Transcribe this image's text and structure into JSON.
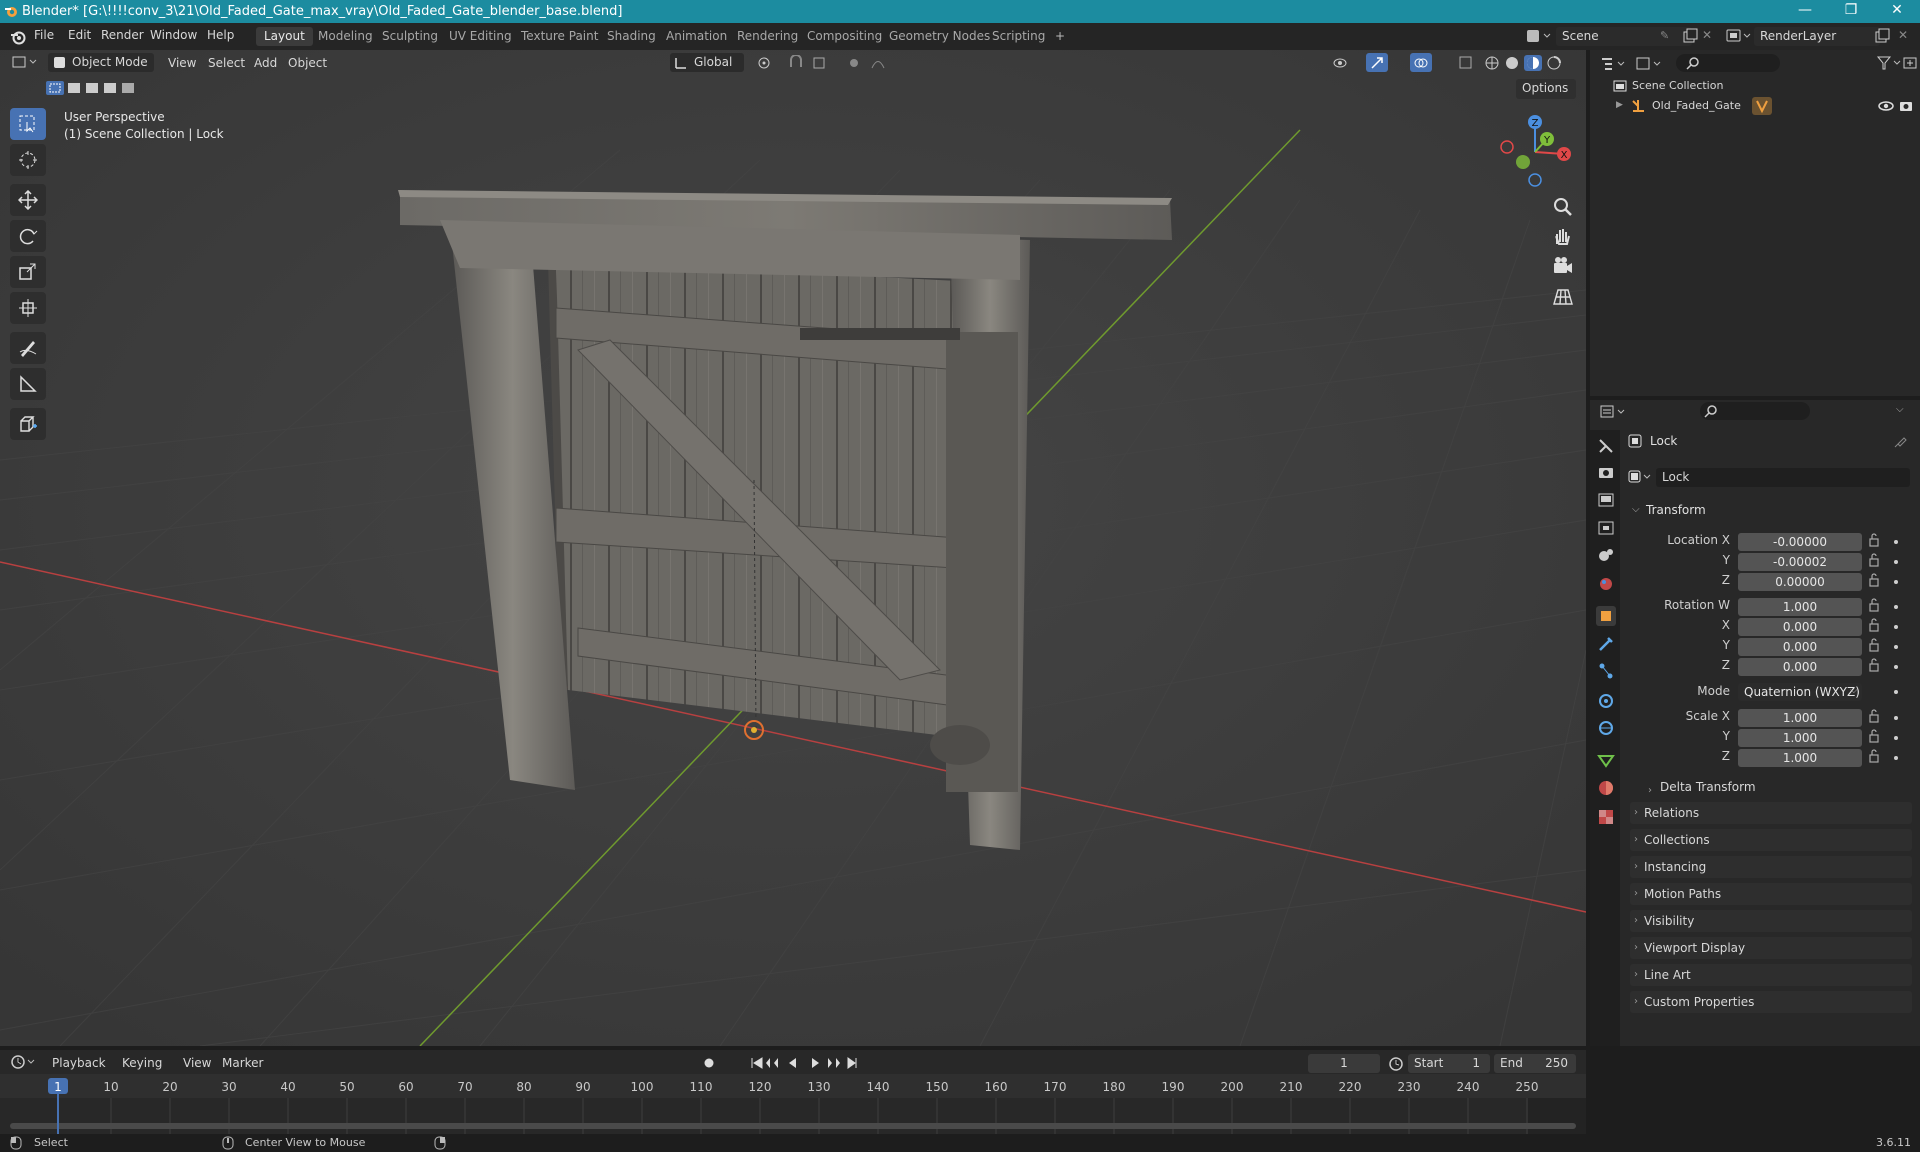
{
  "titlebar": {
    "title": "Blender* [G:\\!!!!conv_3\\21\\Old_Faded_Gate_max_vray\\Old_Faded_Gate_blender_base.blend]",
    "minimize": "—",
    "maximize": "❐",
    "close": "✕"
  },
  "menu": [
    "File",
    "Edit",
    "Render",
    "Window",
    "Help"
  ],
  "workspaces": [
    "Layout",
    "Modeling",
    "Sculpting",
    "UV Editing",
    "Texture Paint",
    "Shading",
    "Animation",
    "Rendering",
    "Compositing",
    "Geometry Nodes",
    "Scripting"
  ],
  "workspace_add": "+",
  "scene": {
    "name": "Scene",
    "view_layer": "RenderLayer"
  },
  "viewport": {
    "mode": "Object Mode",
    "menus": [
      "View",
      "Select",
      "Add",
      "Object"
    ],
    "orientation": "Global",
    "options": "Options",
    "overlay_line1": "User Perspective",
    "overlay_line2": "(1) Scene Collection | Lock",
    "gizmo": {
      "x": "X",
      "y": "Y",
      "z": "Z"
    },
    "colors": {
      "x_axis": "#e04848",
      "y_axis": "#7fbf3a",
      "z_axis": "#4b8fe0",
      "active_tool": "#4772b3"
    }
  },
  "outliner": {
    "root": "Scene Collection",
    "items": [
      {
        "name": "Old_Faded_Gate"
      }
    ]
  },
  "properties": {
    "object_name": "Lock",
    "datablock_name": "Lock",
    "transform_header": "Transform",
    "location": {
      "label_x": "Location X",
      "label_y": "Y",
      "label_z": "Z",
      "x": "-0.00000",
      "y": "-0.00002",
      "z": "0.00000"
    },
    "rotation": {
      "label_w": "Rotation W",
      "label_x": "X",
      "label_y": "Y",
      "label_z": "Z",
      "w": "1.000",
      "x": "0.000",
      "y": "0.000",
      "z": "0.000"
    },
    "mode_label": "Mode",
    "mode_value": "Quaternion (WXYZ)",
    "scale": {
      "label_x": "Scale X",
      "label_y": "Y",
      "label_z": "Z",
      "x": "1.000",
      "y": "1.000",
      "z": "1.000"
    },
    "delta_transform": "Delta Transform",
    "panels": [
      "Relations",
      "Collections",
      "Instancing",
      "Motion Paths",
      "Visibility",
      "Viewport Display",
      "Line Art",
      "Custom Properties"
    ]
  },
  "timeline": {
    "menus": [
      "Playback",
      "Keying",
      "View",
      "Marker"
    ],
    "current_frame": "1",
    "start_label": "Start",
    "start": "1",
    "end_label": "End",
    "end": "250",
    "ticks": [
      "1",
      "10",
      "20",
      "30",
      "40",
      "50",
      "60",
      "70",
      "80",
      "90",
      "100",
      "110",
      "120",
      "130",
      "140",
      "150",
      "160",
      "170",
      "180",
      "190",
      "200",
      "210",
      "220",
      "230",
      "240",
      "250"
    ]
  },
  "statusbar": {
    "select": "Select",
    "center_view": "Center View to Mouse",
    "version": "3.6.11"
  }
}
